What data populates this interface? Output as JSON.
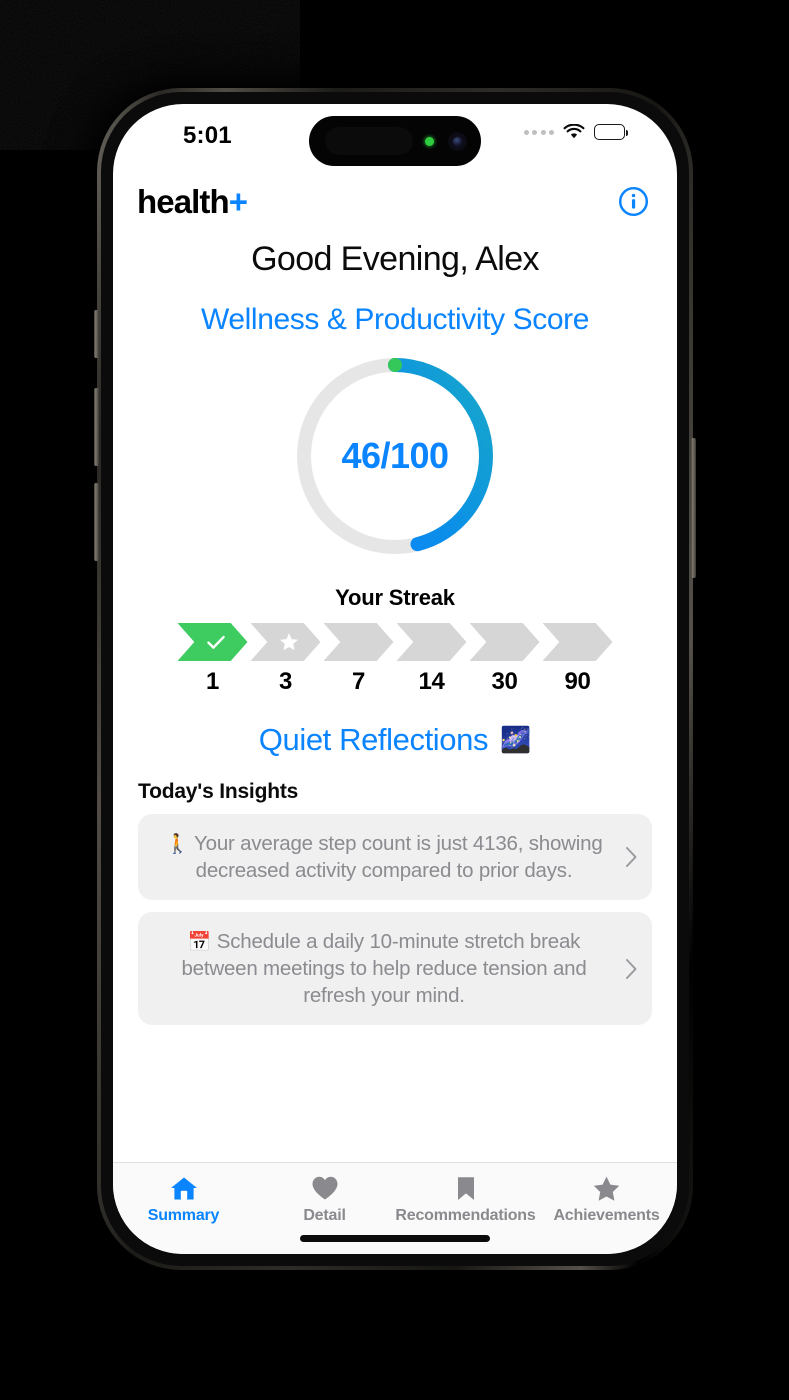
{
  "status_bar": {
    "time": "5:01",
    "signal_icon": "signal-dots-icon",
    "wifi_icon": "wifi-icon",
    "battery_icon": "battery-full-icon"
  },
  "app_bar": {
    "brand_name": "health",
    "brand_suffix": "+",
    "info_icon": "info-circle-icon"
  },
  "header": {
    "greeting": "Good Evening, Alex",
    "score_title": "Wellness & Productivity Score"
  },
  "score_ring": {
    "value_text": "46/100",
    "score": 46,
    "max": 100,
    "percent": 46,
    "track_color": "#e6e6e6",
    "start_color": "#34c759",
    "gradient_from": "#0a84ff",
    "gradient_to": "#17a8c8",
    "value_color": "#0a84ff"
  },
  "streak": {
    "title": "Your Streak",
    "milestones": [
      {
        "label": "1",
        "state": "completed",
        "glyph": "check-icon",
        "color": "#3ecb5f"
      },
      {
        "label": "3",
        "state": "next",
        "glyph": "star-icon",
        "color": "#d6d6d6"
      },
      {
        "label": "7",
        "state": "locked",
        "glyph": "",
        "color": "#d6d6d6"
      },
      {
        "label": "14",
        "state": "locked",
        "glyph": "",
        "color": "#d6d6d6"
      },
      {
        "label": "30",
        "state": "locked",
        "glyph": "",
        "color": "#d6d6d6"
      },
      {
        "label": "90",
        "state": "locked",
        "glyph": "",
        "color": "#d6d6d6"
      }
    ]
  },
  "reflections": {
    "label": "Quiet Reflections",
    "emoji": "🌌"
  },
  "insights": {
    "title": "Today's Insights",
    "items": [
      {
        "emoji": "🚶",
        "text": "Your average step count is just 4136, showing decreased activity compared to prior days.",
        "chevron": "chevron-right-icon"
      },
      {
        "emoji": "📅",
        "text": "Schedule a daily 10-minute stretch break between meetings to help reduce tension and refresh your mind.",
        "chevron": "chevron-right-icon"
      }
    ]
  },
  "tab_bar": {
    "active_color": "#0a84ff",
    "inactive_color": "#8a8a8e",
    "tabs": [
      {
        "label": "Summary",
        "icon": "home-icon",
        "active": true
      },
      {
        "label": "Detail",
        "icon": "heart-icon",
        "active": false
      },
      {
        "label": "Recommendations",
        "icon": "bookmark-icon",
        "active": false
      },
      {
        "label": "Achievements",
        "icon": "star-icon",
        "active": false
      }
    ]
  }
}
